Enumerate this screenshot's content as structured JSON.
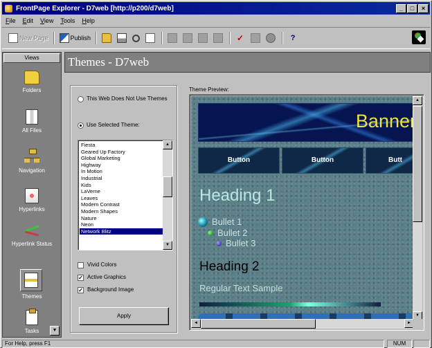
{
  "window": {
    "title": "FrontPage Explorer - D7web [http://p200/d7web]",
    "controls": {
      "minimize": "_",
      "maximize": "□",
      "close": "×"
    }
  },
  "menu": [
    {
      "ul": "F",
      "rest": "ile"
    },
    {
      "ul": "E",
      "rest": "dit"
    },
    {
      "ul": "V",
      "rest": "iew"
    },
    {
      "ul": "T",
      "rest": "ools"
    },
    {
      "ul": "H",
      "rest": "elp"
    }
  ],
  "toolbar": {
    "new_page": "New Page",
    "publish": "Publish"
  },
  "views": {
    "header": "Views",
    "items": [
      "Folders",
      "All Files",
      "Navigation",
      "Hyperlinks",
      "Hyperlink Status",
      "Themes",
      "Tasks"
    ],
    "scroll_glyph": "▼"
  },
  "panel": {
    "title": "Themes - D7web"
  },
  "options": {
    "radio_no_theme": "This Web Does Not Use Themes",
    "radio_selected": "Use Selected Theme:",
    "themes": [
      "Fiesta",
      "Geared Up Factory",
      "Global Marketing",
      "Highway",
      "In Motion",
      "Industrial",
      "Kids",
      "LaVerne",
      "Leaves",
      "Modern Contrast",
      "Modern Shapes",
      "Nature",
      "Neon",
      "Network Blitz"
    ],
    "selected_theme": "Network Blitz",
    "check_vivid": "Vivid Colors",
    "check_active": "Active Graphics",
    "check_background": "Background Image",
    "vivid_checked": false,
    "active_checked": true,
    "background_checked": true,
    "apply": "Apply"
  },
  "preview": {
    "label": "Theme Preview:",
    "banner": "Banner",
    "buttons": [
      "Button",
      "Button",
      "Butt"
    ],
    "heading1": "Heading 1",
    "bullets": [
      "Bullet 1",
      "Bullet 2",
      "Bullet 3"
    ],
    "heading2": "Heading 2",
    "regular": "Regular Text Sample"
  },
  "status": {
    "text": "For Help, press F1",
    "num": "NUM"
  },
  "colors": {
    "title_bar": "#000080",
    "selection": "#000080",
    "banner_text": "#f0e040",
    "preview_bg": "#5d7f87"
  }
}
